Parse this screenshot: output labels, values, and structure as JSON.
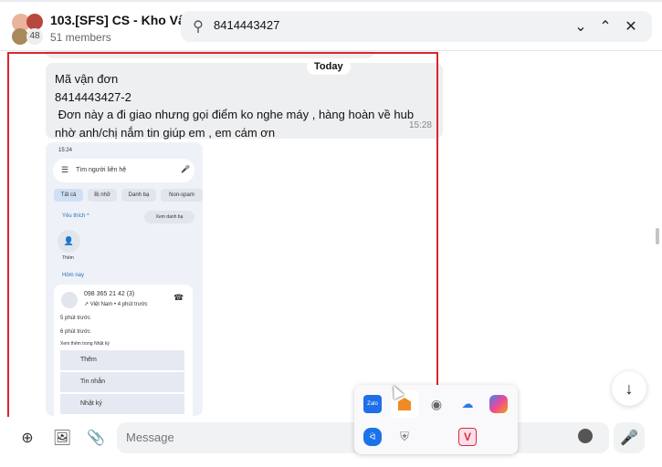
{
  "header": {
    "title": "103.[SFS] CS - Kho Vận",
    "members": "51 members",
    "avatar_count": "48"
  },
  "search": {
    "value": "8414443427",
    "icons": [
      "search-icon",
      "chevron-down-icon",
      "chevron-up-icon",
      "close-icon"
    ]
  },
  "chat": {
    "date_divider": "Today",
    "message": {
      "lines": [
        "Mã vận đơn",
        "8414443427-2",
        " Đơn này a đi giao nhưng gọi điểm ko nghe máy , hàng hoàn về hub",
        "nhờ anh/chị nắm tin giúp em , em cám ơn"
      ],
      "time": "15:28"
    },
    "image": {
      "time": "15:24",
      "search_placeholder": "Tìm người liên hệ",
      "chips": [
        "Tất cả",
        "Bị nhỡ",
        "Danh bạ",
        "Non-spam"
      ],
      "favorites": "Yêu thích ^",
      "view_contacts": "Xem danh bạ",
      "add": "Thêm",
      "today": "Hôm nay",
      "call_number": "098 365 21 42 (3)",
      "call_meta": "↗ Việt Nam • 4 phút trước",
      "earlier1": "5 phút trước",
      "earlier2": "6 phút trước",
      "see_more": "Xem thêm trong Nhật ký",
      "actions": [
        "Thêm",
        "Tin nhắn",
        "Nhật ký"
      ]
    }
  },
  "composer": {
    "placeholder": "Message"
  },
  "tray": {
    "icons": [
      "zalo-icon",
      "ubiquiti-icon",
      "fingerprint-icon",
      "cloud-icon",
      "copilot-icon",
      "bluetooth-icon",
      "security-icon",
      "vnc-icon"
    ],
    "zalo_label": "Zalo",
    "vnc_label": "V"
  },
  "colors": {
    "highlight": "#d9262c",
    "bubble": "#eeeff1"
  }
}
